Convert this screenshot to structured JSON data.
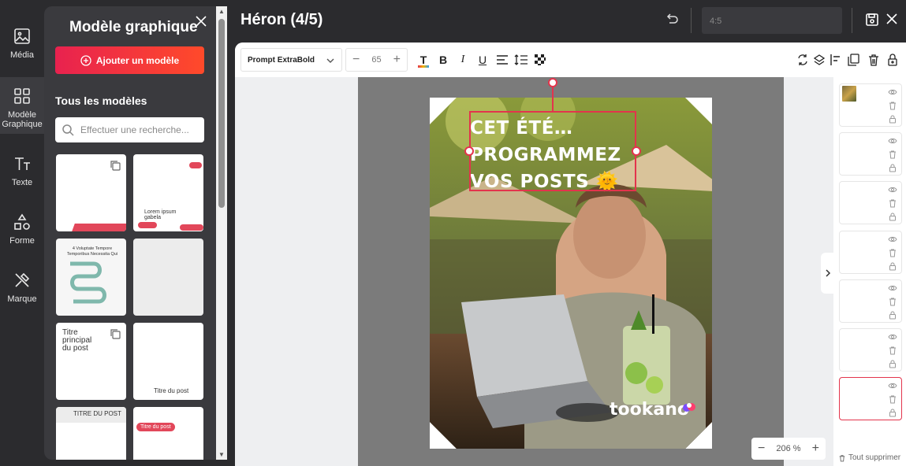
{
  "rail": {
    "items": [
      {
        "label": "Média",
        "icon": "image-icon"
      },
      {
        "label": "Modèle Graphique",
        "icon": "grid-icon"
      },
      {
        "label": "Texte",
        "icon": "text-icon"
      },
      {
        "label": "Forme",
        "icon": "shapes-icon"
      },
      {
        "label": "Marque",
        "icon": "brand-icon"
      }
    ]
  },
  "panel": {
    "title": "Modèle graphique",
    "add_button": "Ajouter un modèle",
    "section_title": "Tous les modèles",
    "search_placeholder": "Effectuer une recherche...",
    "templates": {
      "t2_line1": "Lorem ipsum",
      "t2_line2": "gabela",
      "t3_title": "4 Voluptate Tempore Temporibus Necessita Qui",
      "t5_title": "Titre principal du post",
      "t6_title": "Titre du post",
      "t7_title": "TITRE DU POST",
      "t8_title": "Titre du post"
    }
  },
  "header": {
    "title": "Héron (4/5)",
    "ratio": "4:5"
  },
  "toolbar": {
    "font": "Prompt ExtraBold",
    "font_size": "65"
  },
  "canvas": {
    "headline": "CET ÉTÉ… PROGRAMMEZ VOS POSTS 🌞",
    "brand": "tookano",
    "zoom": "206 %"
  },
  "pages": {
    "count": 7,
    "active_index": 6,
    "delete_all": "Tout supprimer"
  },
  "colors": {
    "accent": "#e3344c",
    "gradient_start": "#e8224f",
    "gradient_end": "#ff4a2a",
    "background": "#2b2b2e"
  }
}
